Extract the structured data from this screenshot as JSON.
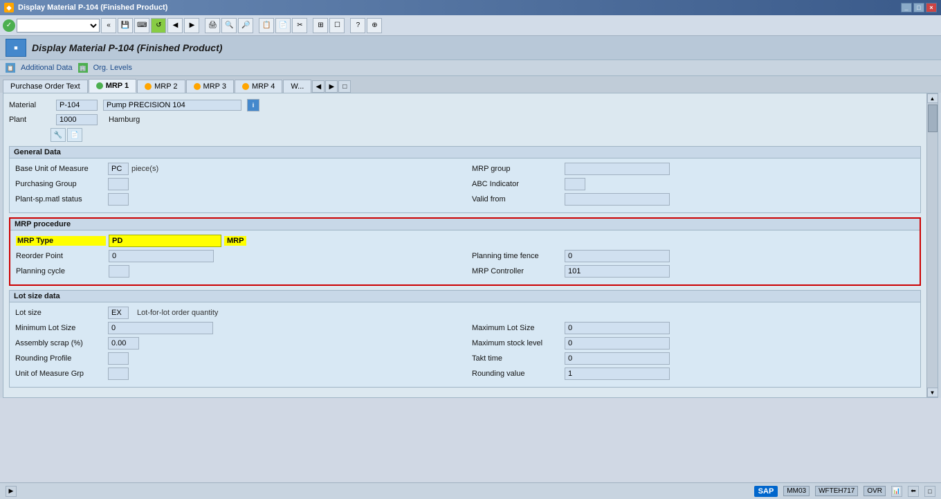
{
  "titleBar": {
    "title": "Display Material P-104 (Finished Product)",
    "buttons": [
      "_",
      "□",
      "×"
    ]
  },
  "header": {
    "icon": "SAP",
    "title": "Display Material P-104 (Finished Product)"
  },
  "actionBar": {
    "additionalData": "Additional Data",
    "orgLevels": "Org. Levels"
  },
  "tabs": [
    {
      "label": "Purchase Order Text",
      "active": false,
      "dot": false
    },
    {
      "label": "MRP 1",
      "active": true,
      "dot": true
    },
    {
      "label": "MRP 2",
      "active": false,
      "dot": true
    },
    {
      "label": "MRP 3",
      "active": false,
      "dot": true
    },
    {
      "label": "MRP 4",
      "active": false,
      "dot": true
    },
    {
      "label": "W...",
      "active": false,
      "dot": false
    }
  ],
  "material": {
    "label": "Material",
    "value": "P-104",
    "description": "Pump PRECISION 104"
  },
  "plant": {
    "label": "Plant",
    "value": "1000",
    "description": "Hamburg"
  },
  "sections": {
    "generalData": {
      "title": "General Data",
      "fields": {
        "baseUnitOfMeasure": {
          "label": "Base Unit of Measure",
          "value": "PC",
          "unit": "piece(s)"
        },
        "mrpGroup": {
          "label": "MRP group",
          "value": ""
        },
        "purchasingGroup": {
          "label": "Purchasing Group",
          "value": ""
        },
        "abcIndicator": {
          "label": "ABC Indicator",
          "value": ""
        },
        "plantSpMatlStatus": {
          "label": "Plant-sp.matl status",
          "value": ""
        },
        "validFrom": {
          "label": "Valid from",
          "value": ""
        }
      }
    },
    "mrpProcedure": {
      "title": "MRP procedure",
      "fields": {
        "mrpType": {
          "label": "MRP Type",
          "code": "PD",
          "value": "MRP"
        },
        "reorderPoint": {
          "label": "Reorder Point",
          "value": "0"
        },
        "planningTimeFence": {
          "label": "Planning time fence",
          "value": "0"
        },
        "planningCycle": {
          "label": "Planning cycle",
          "value": ""
        },
        "mrpController": {
          "label": "MRP Controller",
          "value": "101"
        }
      }
    },
    "lotSizeData": {
      "title": "Lot size data",
      "fields": {
        "lotSize": {
          "label": "Lot size",
          "value": "EX"
        },
        "lotForLot": {
          "label": "Lot-for-lot order quantity",
          "value": ""
        },
        "minimumLotSize": {
          "label": "Minimum Lot Size",
          "value": "0"
        },
        "maximumLotSize": {
          "label": "Maximum Lot Size",
          "value": "0"
        },
        "maximumStockLevel": {
          "label": "Maximum stock level",
          "value": "0"
        },
        "assemblyScrap": {
          "label": "Assembly scrap (%)",
          "value": "0.00"
        },
        "taktTime": {
          "label": "Takt time",
          "value": "0"
        },
        "roundingProfile": {
          "label": "Rounding Profile",
          "value": ""
        },
        "roundingValue": {
          "label": "Rounding value",
          "value": "1"
        },
        "unitOfMeasureGrp": {
          "label": "Unit of Measure Grp",
          "value": ""
        }
      }
    }
  },
  "statusBar": {
    "navBtn": "▶",
    "transaction": "MM03",
    "user": "WFTEH717",
    "mode": "OVR",
    "sapLogo": "SAP"
  }
}
